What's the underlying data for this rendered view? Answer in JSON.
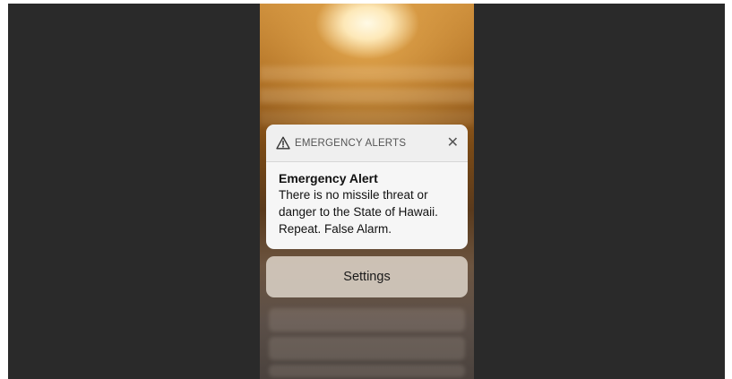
{
  "notification": {
    "app_name": "EMERGENCY ALERTS",
    "title": "Emergency Alert",
    "message": "There is no missile threat or danger to the State of Hawaii. Repeat. False Alarm."
  },
  "actions": {
    "settings_label": "Settings"
  },
  "icons": {
    "header": "warning-triangle-icon",
    "dismiss": "close-icon"
  },
  "colors": {
    "card_background": "#f6f6f6",
    "frame_background": "#2a2a2a"
  }
}
